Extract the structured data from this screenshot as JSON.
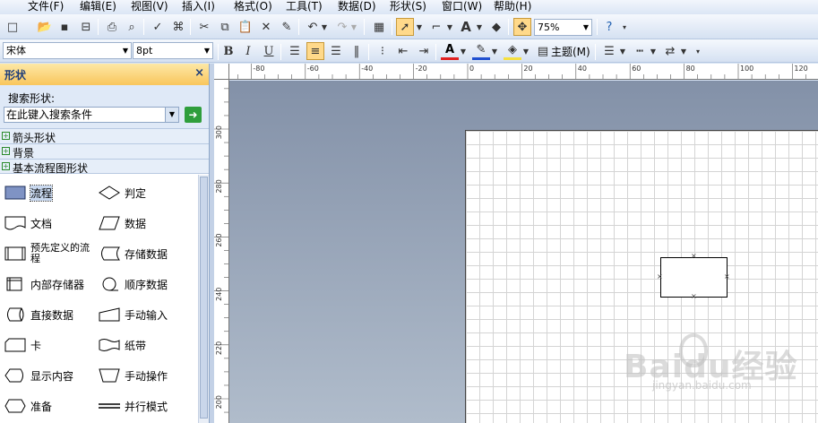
{
  "menubar": {
    "items": [
      "文件(F)",
      "编辑(E)",
      "视图(V)",
      "插入(I)",
      "格式(O)",
      "工具(T)",
      "数据(D)",
      "形状(S)",
      "窗口(W)",
      "帮助(H)"
    ]
  },
  "toolbar": {
    "zoom": "75%",
    "text_tool": "A",
    "font_name": "宋体",
    "font_size": "8pt",
    "bold": "B",
    "italic": "I",
    "underline": "U",
    "theme_label": "主题(M)"
  },
  "shapes_panel": {
    "title": "形状",
    "search_label": "搜索形状:",
    "search_placeholder": "在此键入搜索条件",
    "stencils": [
      "箭头形状",
      "背景",
      "基本流程图形状"
    ],
    "shapes": [
      {
        "name": "流程",
        "icon": "process-icon",
        "selected": true
      },
      {
        "name": "判定",
        "icon": "decision-icon"
      },
      {
        "name": "文档",
        "icon": "document-icon"
      },
      {
        "name": "数据",
        "icon": "data-icon"
      },
      {
        "name": "预先定义的流程",
        "icon": "predefined-process-icon"
      },
      {
        "name": "存储数据",
        "icon": "stored-data-icon"
      },
      {
        "name": "内部存储器",
        "icon": "internal-storage-icon"
      },
      {
        "name": "顺序数据",
        "icon": "sequential-data-icon"
      },
      {
        "name": "直接数据",
        "icon": "direct-data-icon"
      },
      {
        "name": "手动输入",
        "icon": "manual-input-icon"
      },
      {
        "name": "卡",
        "icon": "card-icon"
      },
      {
        "name": "纸带",
        "icon": "paper-tape-icon"
      },
      {
        "name": "显示内容",
        "icon": "display-icon"
      },
      {
        "name": "手动操作",
        "icon": "manual-operation-icon"
      },
      {
        "name": "准备",
        "icon": "preparation-icon"
      },
      {
        "name": "并行模式",
        "icon": "parallel-mode-icon"
      }
    ]
  },
  "rulers": {
    "horizontal": [
      "-80",
      "-60",
      "-40",
      "-20",
      "0",
      "20",
      "40",
      "60",
      "80",
      "100",
      "120"
    ],
    "vertical": [
      "300",
      "280",
      "260",
      "240",
      "220",
      "200"
    ]
  },
  "watermark": {
    "text": "Baidu经验",
    "subtext": "jingyan.baidu.com"
  }
}
